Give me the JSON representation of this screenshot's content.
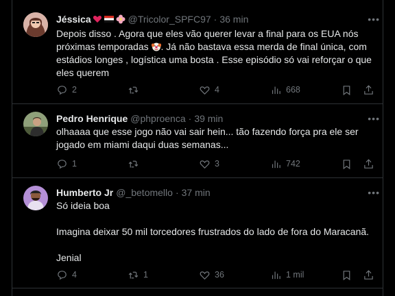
{
  "tweets": [
    {
      "name": "Jéssica",
      "handle": "@Tricolor_SPFC97",
      "time": "36 min",
      "lines": [
        "Depois disso . Agora que eles vão querer levar a final para os EUA nós",
        "próximas temporadas",
        ". Já não bastava essa merda de final única, com",
        "estádios longes , logística uma bosta . Esse episódio só vai reforçar o que",
        "eles querem"
      ],
      "replies": "2",
      "retweets": "",
      "likes": "4",
      "views": "668"
    },
    {
      "name": "Pedro Henrique",
      "handle": "@phproenca",
      "time": "39 min",
      "lines": [
        "olhaaaa que esse jogo não vai sair hein... tão fazendo força pra ele ser",
        "jogado em miami daqui duas semanas..."
      ],
      "replies": "1",
      "retweets": "",
      "likes": "3",
      "views": "742"
    },
    {
      "name": "Humberto Jr",
      "handle": "@_betomello",
      "time": "37 min",
      "lines": [
        "Só ideia boa",
        "Imagina deixar 50 mil torcedores frustrados do lado de fora do Maracanã.",
        "Jenial"
      ],
      "replies": "4",
      "retweets": "1",
      "likes": "36",
      "views": "1 mil"
    }
  ],
  "colors": {
    "background": "#000000",
    "text": "#e7e9ea",
    "muted": "#71767b",
    "border": "#2f3336"
  },
  "icons": [
    "reply-icon",
    "retweet-icon",
    "like-icon",
    "views-icon",
    "bookmark-icon",
    "share-icon",
    "more-icon"
  ]
}
